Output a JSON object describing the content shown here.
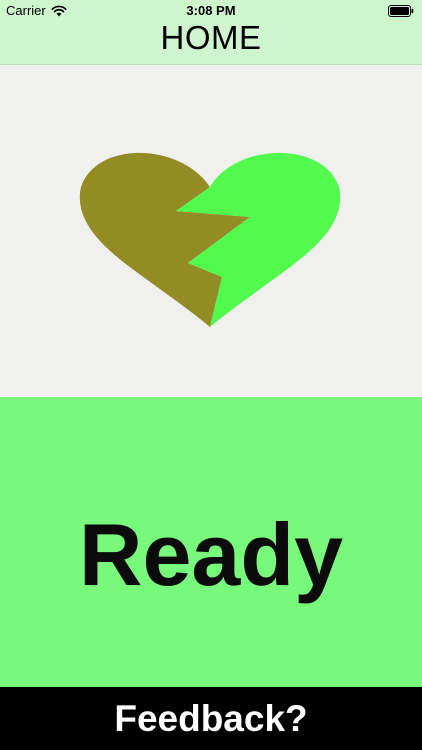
{
  "status_bar": {
    "carrier": "Carrier",
    "time": "3:08 PM"
  },
  "nav": {
    "title": "HOME"
  },
  "main": {
    "status_text": "Ready",
    "heart_colors": {
      "left": "#938b23",
      "right": "#52fa4e"
    },
    "panel_color": "#78f97c"
  },
  "footer": {
    "feedback_label": "Feedback?"
  }
}
